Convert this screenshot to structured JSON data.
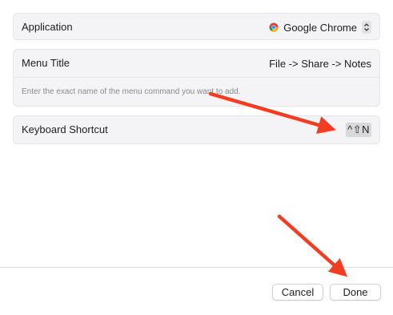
{
  "application": {
    "label": "Application",
    "value": "Google Chrome"
  },
  "menu_title": {
    "label": "Menu Title",
    "value": "File -> Share -> Notes",
    "hint": "Enter the exact name of the menu command you want to add."
  },
  "keyboard_shortcut": {
    "label": "Keyboard Shortcut",
    "value": "^⇧N"
  },
  "buttons": {
    "cancel": "Cancel",
    "done": "Done"
  },
  "colors": {
    "annotation_arrow": "#f23d22",
    "group_background": "#f4f4f6"
  }
}
